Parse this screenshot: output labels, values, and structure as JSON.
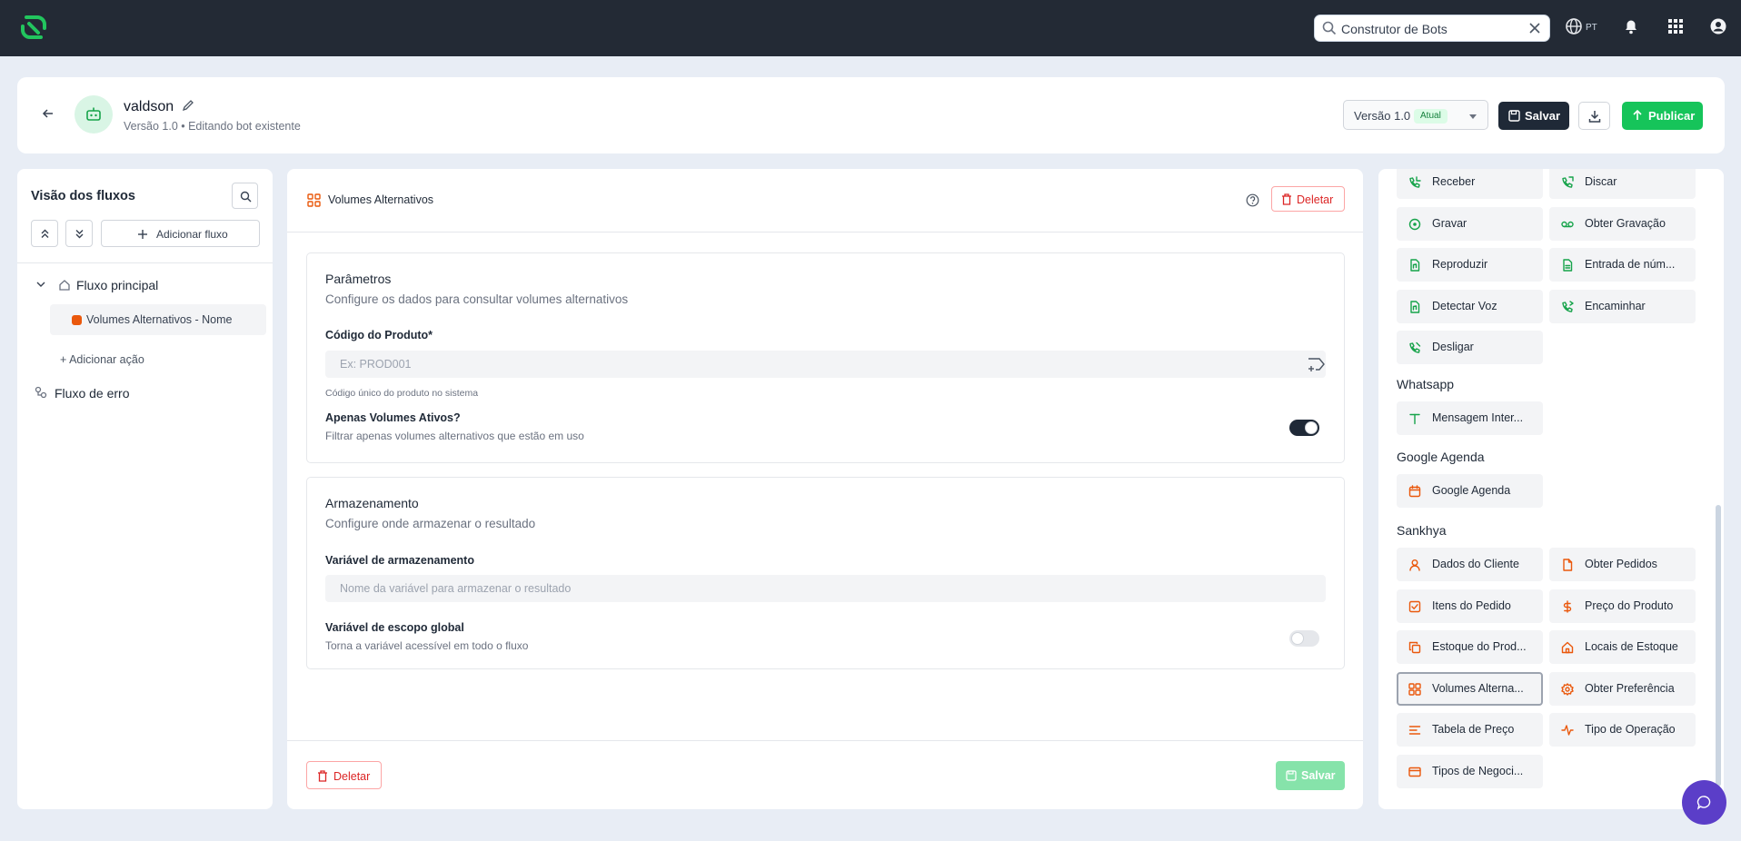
{
  "topbar": {
    "search_value": "Construtor de Bots",
    "language": "PT",
    "icons": [
      "app-logo",
      "search-icon",
      "clear-icon",
      "globe-icon",
      "bell-icon",
      "apps-grid-icon",
      "user-icon"
    ]
  },
  "header": {
    "bot_name": "valdson",
    "bot_subtitle": "Versão 1.0 • Editando bot existente",
    "version_label": "Versão 1.0",
    "version_badge": "Atual",
    "save_label": "Salvar",
    "publish_label": "Publicar"
  },
  "left_panel": {
    "title": "Visão dos fluxos",
    "add_flow_label": "Adicionar fluxo",
    "main_flow_label": "Fluxo principal",
    "selected_action_label": "Volumes Alternativos - Nome",
    "add_action_label": "+ Adicionar ação",
    "error_flow_label": "Fluxo de erro"
  },
  "editor": {
    "title": "Volumes Alternativos",
    "delete_label": "Deletar",
    "parameters": {
      "title": "Parâmetros",
      "subtitle": "Configure os dados para consultar volumes alternativos",
      "product_code_label": "Código do Produto*",
      "product_code_placeholder": "Ex: PROD001",
      "product_code_value": "",
      "product_code_help": "Código único do produto no sistema",
      "active_only_label": "Apenas Volumes Ativos?",
      "active_only_desc": "Filtrar apenas volumes alternativos que estão em uso",
      "active_only_on": true
    },
    "storage": {
      "title": "Armazenamento",
      "subtitle": "Configure onde armazenar o resultado",
      "variable_label": "Variável de armazenamento",
      "variable_placeholder": "Nome da variável para armazenar o resultado",
      "variable_value": "",
      "global_scope_label": "Variável de escopo global",
      "global_scope_desc": "Torna a variável acessível em todo o fluxo",
      "global_scope_on": false
    },
    "footer_delete_label": "Deletar",
    "footer_save_label": "Salvar"
  },
  "actions_panel": {
    "voice_items": [
      {
        "label": "Receber",
        "icon": "phone-incoming-icon"
      },
      {
        "label": "Discar",
        "icon": "phone-outgoing-icon"
      },
      {
        "label": "Gravar",
        "icon": "record-icon"
      },
      {
        "label": "Obter Gravação",
        "icon": "voicemail-icon"
      },
      {
        "label": "Reproduzir",
        "icon": "file-audio-icon"
      },
      {
        "label": "Entrada de núm...",
        "icon": "file-number-icon"
      },
      {
        "label": "Detectar Voz",
        "icon": "file-audio-icon"
      },
      {
        "label": "Encaminhar",
        "icon": "phone-forward-icon"
      },
      {
        "label": "Desligar",
        "icon": "phone-hangup-icon"
      }
    ],
    "whatsapp_title": "Whatsapp",
    "whatsapp_items": [
      {
        "label": "Mensagem Inter...",
        "icon": "text-icon"
      }
    ],
    "google_title": "Google Agenda",
    "google_items": [
      {
        "label": "Google Agenda",
        "icon": "calendar-icon"
      }
    ],
    "sankhya_title": "Sankhya",
    "sankhya_items": [
      {
        "label": "Dados do Cliente",
        "icon": "user-icon"
      },
      {
        "label": "Obter Pedidos",
        "icon": "file-icon"
      },
      {
        "label": "Itens do Pedido",
        "icon": "checkbox-icon"
      },
      {
        "label": "Preço do Produto",
        "icon": "dollar-icon"
      },
      {
        "label": "Estoque do Prod...",
        "icon": "copy-icon"
      },
      {
        "label": "Locais de Estoque",
        "icon": "home-icon"
      },
      {
        "label": "Volumes Alterna...",
        "icon": "grid-icon"
      },
      {
        "label": "Obter Preferência",
        "icon": "gear-icon"
      },
      {
        "label": "Tabela de Preço",
        "icon": "list-icon"
      },
      {
        "label": "Tipo de Operação",
        "icon": "activity-icon"
      },
      {
        "label": "Tipos de Negoci...",
        "icon": "card-icon"
      }
    ],
    "colors": {
      "voice_icon": "#16a34a",
      "sankhya_icon": "#ea580c",
      "whatsapp_icon": "#16a34a"
    }
  }
}
